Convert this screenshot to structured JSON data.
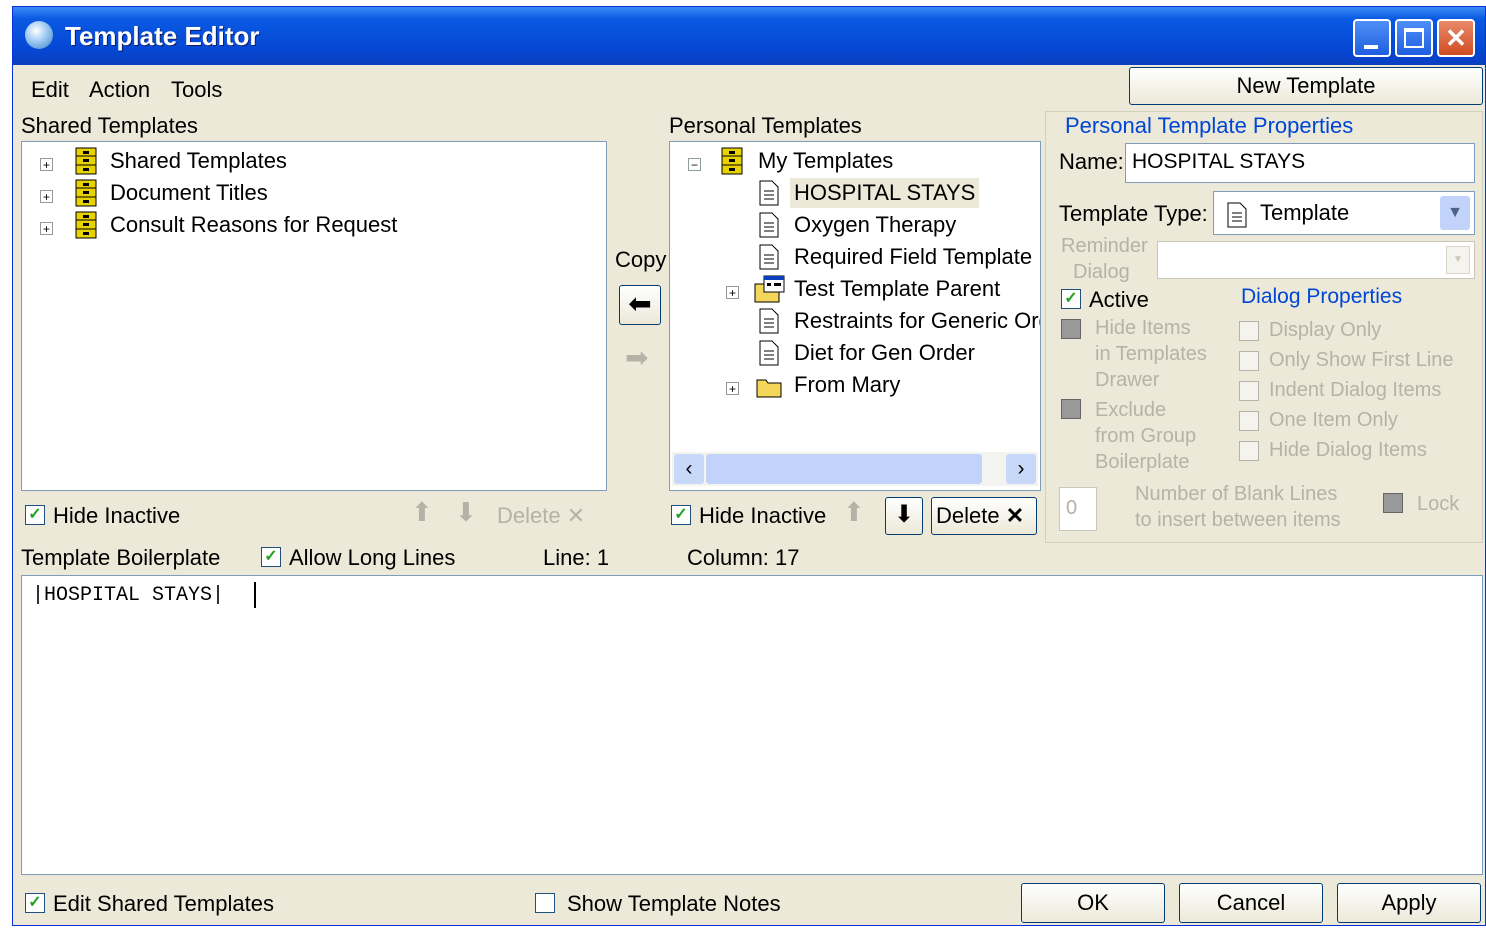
{
  "window": {
    "title": "Template Editor"
  },
  "menu": {
    "edit": "Edit",
    "action": "Action",
    "tools": "Tools"
  },
  "new_template_button": "New Template",
  "shared": {
    "heading": "Shared Templates",
    "items": [
      {
        "label": "Shared Templates",
        "icon": "template-drawer-icon"
      },
      {
        "label": "Document Titles",
        "icon": "template-drawer-icon"
      },
      {
        "label": "Consult Reasons for Request",
        "icon": "template-drawer-icon"
      }
    ],
    "hide_inactive": "Hide Inactive",
    "delete": "Delete"
  },
  "copy": {
    "label": "Copy"
  },
  "personal": {
    "heading": "Personal Templates",
    "root": "My Templates",
    "items": [
      {
        "label": "HOSPITAL STAYS",
        "icon": "document-icon",
        "selected": true
      },
      {
        "label": "Oxygen Therapy",
        "icon": "document-icon"
      },
      {
        "label": "Required Field Template",
        "icon": "document-icon"
      },
      {
        "label": "Test Template Parent",
        "icon": "dialog-folder-icon"
      },
      {
        "label": "Restraints for Generic Ord",
        "icon": "document-icon"
      },
      {
        "label": "Diet for Gen Order",
        "icon": "document-icon"
      },
      {
        "label": "From Mary",
        "icon": "folder-icon"
      }
    ],
    "hide_inactive": "Hide Inactive",
    "delete": "Delete"
  },
  "props": {
    "heading": "Personal Template Properties",
    "name_label": "Name:",
    "name_value": "HOSPITAL STAYS",
    "type_label": "Template Type:",
    "type_value": "Template",
    "reminder_label_1": "Reminder",
    "reminder_label_2": "Dialog",
    "active": "Active",
    "hide_items_1": "Hide Items",
    "hide_items_2": "in Templates",
    "hide_items_3": "Drawer",
    "exclude_1": "Exclude",
    "exclude_2": "from Group",
    "exclude_3": "Boilerplate",
    "dialog_props": "Dialog Properties",
    "display_only": "Display Only",
    "only_first": "Only Show First Line",
    "indent": "Indent Dialog Items",
    "one_item": "One Item Only",
    "hide_dialog": "Hide Dialog Items",
    "blank_value": "0",
    "blank_lines_1": "Number of Blank Lines",
    "blank_lines_2": "to insert between items",
    "lock": "Lock"
  },
  "boilerplate": {
    "label": "Template Boilerplate",
    "allow_long": "Allow Long Lines",
    "line": "Line: 1",
    "column": "Column: 17",
    "text": "|HOSPITAL STAYS|"
  },
  "footer": {
    "edit_shared": "Edit Shared Templates",
    "show_notes": "Show Template Notes",
    "ok": "OK",
    "cancel": "Cancel",
    "apply": "Apply"
  }
}
